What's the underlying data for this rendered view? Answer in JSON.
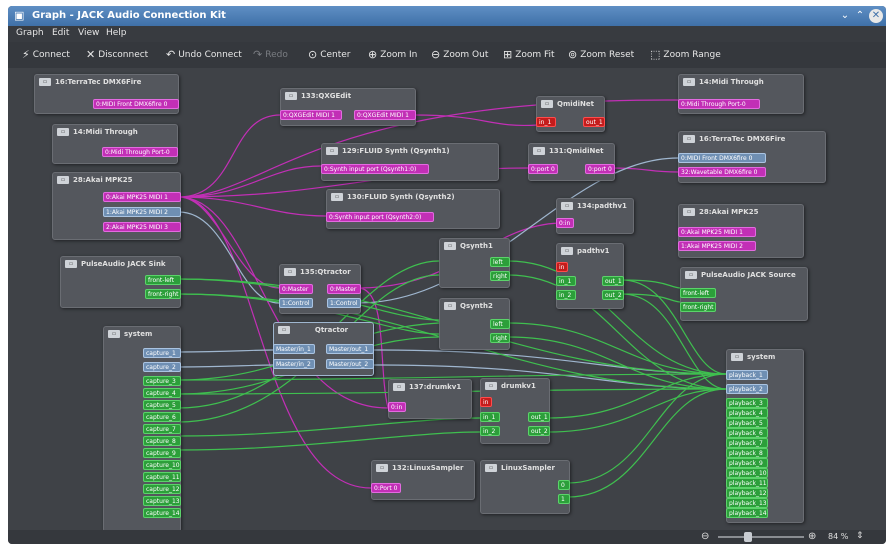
{
  "window": {
    "title": "Graph - JACK Audio Connection Kit"
  },
  "menu": {
    "graph": "Graph",
    "edit": "Edit",
    "view": "View",
    "help": "Help"
  },
  "toolbar": {
    "connect": "Connect",
    "disconnect": "Disconnect",
    "undo": "Undo Connect",
    "redo": "Redo",
    "center": "Center",
    "zoom_in": "Zoom In",
    "zoom_out": "Zoom Out",
    "zoom_fit": "Zoom Fit",
    "zoom_reset": "Zoom Reset",
    "zoom_range": "Zoom Range"
  },
  "status": {
    "zoom": "84 %"
  },
  "nodes": {
    "terratec_out": {
      "title": "16:TerraTec DMX6Fire",
      "ports": [
        "0:MIDI Front DMX6fire 0"
      ]
    },
    "midi_through_out": {
      "title": "14:Midi Through",
      "ports": [
        "0:Midi Through Port-0"
      ]
    },
    "akai_out": {
      "title": "28:Akai MPK25",
      "ports": [
        "0:Akai MPK25 MIDI 1",
        "1:Akai MPK25 MIDI 2",
        "2:Akai MPK25 MIDI 3"
      ]
    },
    "qxgedit": {
      "title": "133:QXGEdit",
      "in": "0:QXGEdit MIDI 1",
      "out": "0:QXGEdit MIDI 1"
    },
    "fluid1": {
      "title": "129:FLUID Synth (Qsynth1)",
      "ports": [
        "0:Synth input port (Qsynth1:0)"
      ]
    },
    "fluid2": {
      "title": "130:FLUID Synth (Qsynth2)",
      "ports": [
        "0:Synth input port (Qsynth2:0)"
      ]
    },
    "qmidinet_top": {
      "title": "QmidiNet",
      "ports": [
        "in_1",
        "out_1"
      ]
    },
    "qmidinet_131": {
      "title": "131:QmidiNet",
      "in": "0:port 0",
      "out": "0:port 0"
    },
    "padthv1_134": {
      "title": "134:padthv1",
      "ports": [
        "0:in"
      ]
    },
    "midi_through_in": {
      "title": "14:Midi Through",
      "ports": [
        "0:Midi Through Port-0"
      ]
    },
    "terratec_in": {
      "title": "16:TerraTec DMX6Fire",
      "ports": [
        "0:MIDI Front DMX6fire 0",
        "32:Wavetable DMX6fire 0"
      ]
    },
    "akai_in": {
      "title": "28:Akai MPK25",
      "ports": [
        "0:Akai MPK25 MIDI 1",
        "1:Akai MPK25 MIDI 2"
      ]
    },
    "pulse_sink": {
      "title": "PulseAudio JACK Sink",
      "ports": [
        "front-left",
        "front-right"
      ]
    },
    "qtractor_135": {
      "title": "135:Qtractor",
      "in": [
        "0:Master",
        "1:Control"
      ],
      "out": [
        "0:Master",
        "1:Control"
      ]
    },
    "qsynth1": {
      "title": "Qsynth1",
      "ports": [
        "left",
        "right"
      ]
    },
    "qsynth2": {
      "title": "Qsynth2",
      "ports": [
        "left",
        "right"
      ]
    },
    "padthv1": {
      "title": "padthv1",
      "in": [
        "in",
        "in_1",
        "in_2"
      ],
      "out": [
        "out_1",
        "out_2"
      ]
    },
    "pulse_source": {
      "title": "PulseAudio JACK Source",
      "ports": [
        "front-left",
        "front-right"
      ]
    },
    "system_cap": {
      "title": "system",
      "ports": [
        "capture_1",
        "capture_2",
        "capture_3",
        "capture_4",
        "capture_5",
        "capture_6",
        "capture_7",
        "capture_8",
        "capture_9",
        "capture_10",
        "capture_11",
        "capture_12",
        "capture_13",
        "capture_14"
      ]
    },
    "qtractor": {
      "title": "Qtractor",
      "in": [
        "Master/in_1",
        "Master/in_2"
      ],
      "out": [
        "Master/out_1",
        "Master/out_2"
      ]
    },
    "drumkv1_137": {
      "title": "137:drumkv1",
      "ports": [
        "0:in"
      ]
    },
    "drumkv1": {
      "title": "drumkv1",
      "in": [
        "in",
        "in_1",
        "in_2"
      ],
      "out": [
        "out_1",
        "out_2"
      ]
    },
    "linuxsampler_132": {
      "title": "132:LinuxSampler",
      "ports": [
        "0:Port 0"
      ]
    },
    "linuxsampler": {
      "title": "LinuxSampler",
      "ports": [
        "0",
        "1"
      ]
    },
    "system_play": {
      "title": "system",
      "ports": [
        "playback_1",
        "playback_2",
        "playback_3",
        "playback_4",
        "playback_5",
        "playback_6",
        "playback_7",
        "playback_8",
        "playback_9",
        "playback_10",
        "playback_11",
        "playback_12",
        "playback_13",
        "playback_14"
      ]
    }
  }
}
